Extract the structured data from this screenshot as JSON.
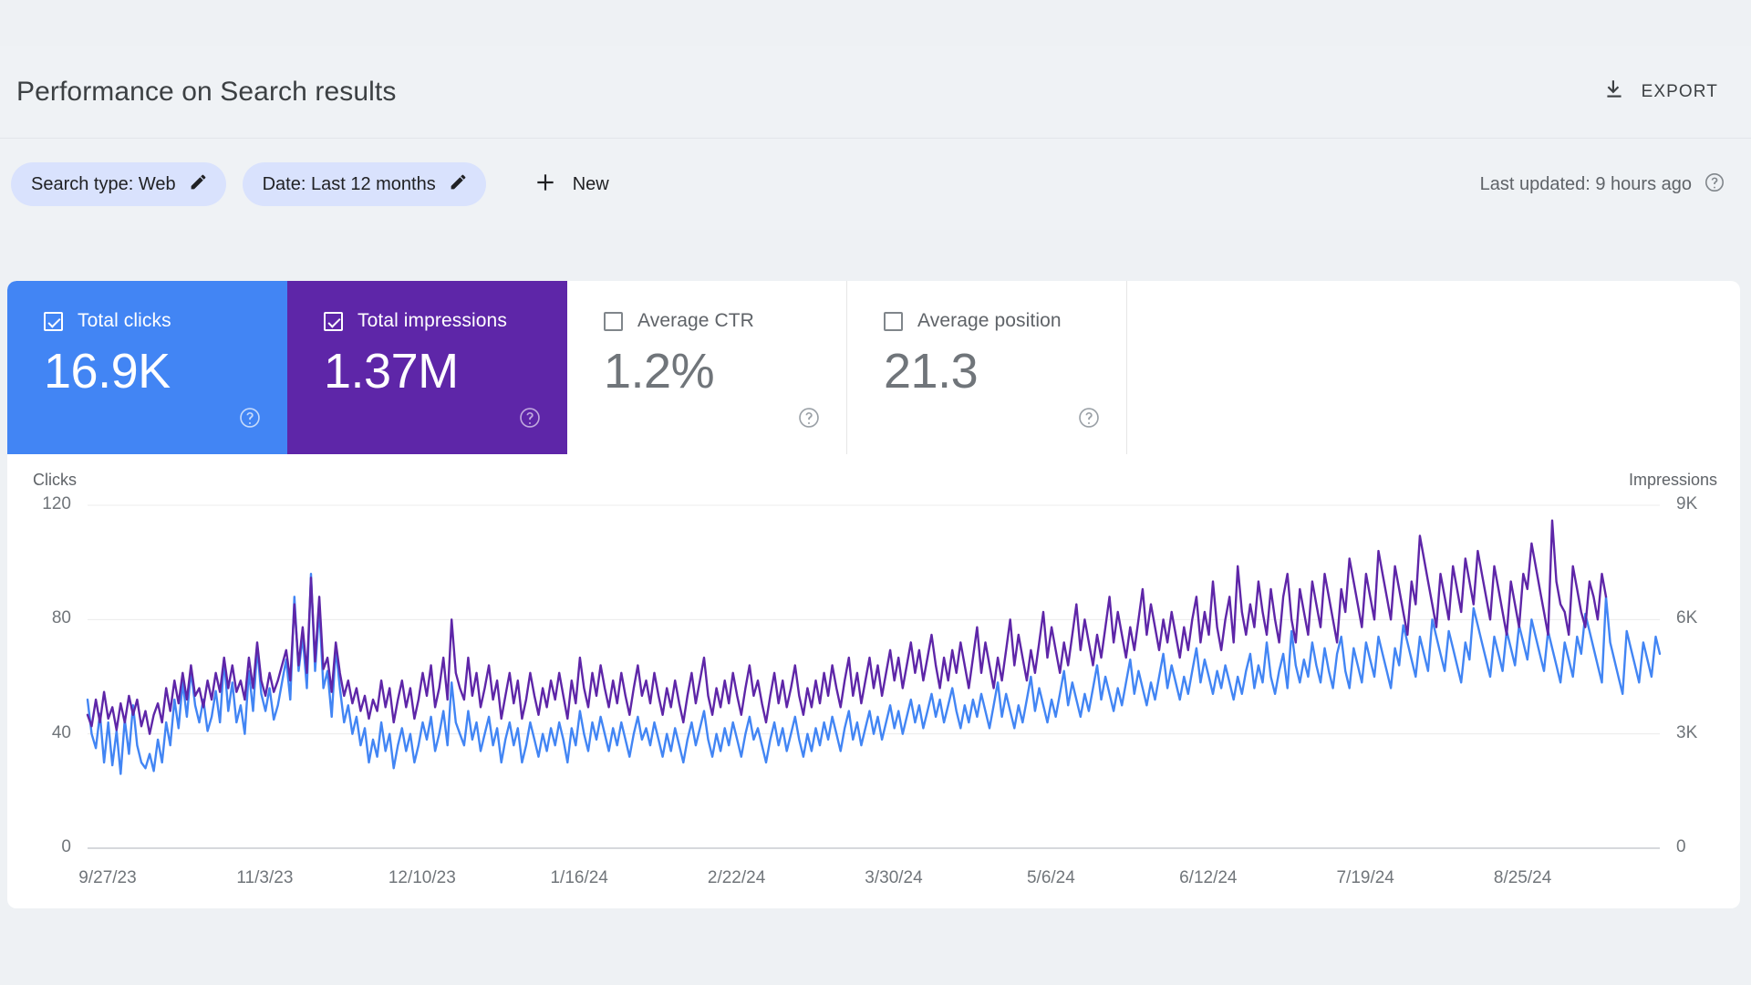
{
  "header": {
    "title": "Performance on Search results",
    "export_label": "EXPORT",
    "export_icon": "download-icon"
  },
  "filters": {
    "chips": [
      {
        "label": "Search type: Web",
        "edit_icon": "pencil-icon"
      },
      {
        "label": "Date: Last 12 months",
        "edit_icon": "pencil-icon"
      }
    ],
    "new_label": "New",
    "new_icon": "plus-icon",
    "last_updated": "Last updated: 9 hours ago",
    "help_icon": "help-circle-icon"
  },
  "metrics": [
    {
      "label": "Total clicks",
      "value": "16.9K",
      "checked": true,
      "color": "#4285f4",
      "help_icon": "help-circle-icon"
    },
    {
      "label": "Total impressions",
      "value": "1.37M",
      "checked": true,
      "color": "#5e26a8",
      "help_icon": "help-circle-icon"
    },
    {
      "label": "Average CTR",
      "value": "1.2%",
      "checked": false,
      "color": "#ffffff",
      "help_icon": "help-circle-icon"
    },
    {
      "label": "Average position",
      "value": "21.3",
      "checked": false,
      "color": "#ffffff",
      "help_icon": "help-circle-icon"
    }
  ],
  "chart_data": {
    "type": "line",
    "title": "",
    "xlabel": "",
    "ylabel": "Clicks",
    "y2label": "Impressions",
    "grid": true,
    "legend": "none",
    "ylim": [
      0,
      120
    ],
    "y2lim": [
      0,
      9000
    ],
    "yticks": [
      "0",
      "40",
      "80",
      "120"
    ],
    "y2ticks": [
      "0",
      "3K",
      "6K",
      "9K"
    ],
    "xticks": [
      "9/27/23",
      "11/3/23",
      "12/10/23",
      "1/16/24",
      "2/22/24",
      "3/30/24",
      "5/6/24",
      "6/12/24",
      "7/19/24",
      "8/25/24"
    ],
    "series": [
      {
        "name": "Total clicks",
        "color": "#4285f4",
        "axis": "left",
        "values": [
          52,
          40,
          35,
          47,
          30,
          44,
          29,
          41,
          26,
          45,
          33,
          50,
          36,
          30,
          28,
          33,
          27,
          38,
          30,
          44,
          36,
          52,
          42,
          58,
          46,
          62,
          50,
          44,
          52,
          41,
          46,
          55,
          44,
          66,
          48,
          58,
          44,
          50,
          40,
          62,
          48,
          70,
          54,
          48,
          56,
          45,
          50,
          58,
          66,
          52,
          88,
          62,
          74,
          56,
          96,
          62,
          84,
          56,
          62,
          46,
          70,
          56,
          44,
          50,
          40,
          46,
          36,
          42,
          30,
          38,
          32,
          44,
          34,
          40,
          28,
          36,
          42,
          34,
          40,
          30,
          36,
          44,
          38,
          46,
          34,
          40,
          48,
          36,
          58,
          44,
          40,
          36,
          48,
          38,
          44,
          34,
          40,
          46,
          36,
          42,
          30,
          38,
          44,
          36,
          42,
          30,
          36,
          44,
          38,
          32,
          40,
          34,
          42,
          36,
          44,
          38,
          30,
          42,
          36,
          48,
          40,
          34,
          44,
          38,
          46,
          40,
          34,
          42,
          36,
          44,
          38,
          32,
          40,
          46,
          38,
          42,
          36,
          44,
          38,
          32,
          40,
          34,
          42,
          36,
          30,
          38,
          44,
          36,
          42,
          48,
          38,
          32,
          40,
          34,
          42,
          36,
          44,
          38,
          32,
          40,
          46,
          38,
          42,
          36,
          30,
          38,
          44,
          36,
          42,
          34,
          40,
          46,
          38,
          32,
          40,
          34,
          42,
          36,
          44,
          38,
          46,
          40,
          34,
          42,
          48,
          38,
          44,
          36,
          42,
          48,
          40,
          46,
          38,
          44,
          50,
          42,
          48,
          40,
          46,
          52,
          44,
          50,
          42,
          48,
          54,
          46,
          52,
          44,
          50,
          56,
          48,
          42,
          50,
          44,
          52,
          46,
          54,
          48,
          42,
          50,
          58,
          46,
          54,
          48,
          42,
          50,
          44,
          52,
          60,
          48,
          56,
          50,
          44,
          52,
          46,
          54,
          62,
          50,
          58,
          52,
          46,
          54,
          48,
          56,
          64,
          52,
          60,
          54,
          48,
          56,
          50,
          58,
          66,
          54,
          62,
          56,
          50,
          58,
          52,
          60,
          68,
          56,
          64,
          58,
          52,
          60,
          54,
          62,
          70,
          58,
          66,
          60,
          54,
          62,
          56,
          64,
          58,
          52,
          60,
          54,
          62,
          68,
          56,
          64,
          58,
          72,
          60,
          54,
          62,
          68,
          56,
          76,
          64,
          58,
          66,
          60,
          72,
          64,
          58,
          70,
          62,
          56,
          68,
          74,
          62,
          56,
          70,
          64,
          58,
          72,
          66,
          60,
          74,
          68,
          62,
          56,
          70,
          64,
          78,
          72,
          66,
          60,
          74,
          68,
          62,
          80,
          74,
          68,
          62,
          76,
          70,
          64,
          58,
          72,
          66,
          84,
          78,
          72,
          66,
          60,
          74,
          68,
          62,
          76,
          70,
          64,
          78,
          72,
          66,
          80,
          74,
          68,
          62,
          76,
          70,
          64,
          58,
          72,
          66,
          60,
          74,
          68,
          82,
          76,
          70,
          64,
          58,
          88,
          72,
          66,
          60,
          54,
          76,
          70,
          64,
          58,
          72,
          66,
          60,
          74,
          68
        ]
      },
      {
        "name": "Total impressions",
        "color": "#5e26a8",
        "axis": "right",
        "values": [
          3500,
          3200,
          3900,
          3300,
          4100,
          3400,
          3700,
          3100,
          3800,
          3300,
          4000,
          3500,
          3900,
          3200,
          3600,
          3000,
          3500,
          3800,
          3300,
          4200,
          3600,
          4400,
          3800,
          4600,
          3900,
          4800,
          4000,
          4200,
          3700,
          4400,
          3900,
          4600,
          4100,
          5000,
          4200,
          4800,
          4100,
          4400,
          3900,
          5000,
          4200,
          5400,
          4400,
          4000,
          4600,
          4100,
          4400,
          4800,
          5200,
          4400,
          6400,
          4800,
          5800,
          4600,
          7100,
          4900,
          6600,
          4700,
          5000,
          4100,
          5400,
          4600,
          4000,
          4400,
          3800,
          4200,
          3600,
          4000,
          3400,
          3900,
          3600,
          4400,
          3700,
          4200,
          3300,
          3900,
          4400,
          3700,
          4200,
          3400,
          3900,
          4600,
          4000,
          4800,
          3700,
          4200,
          5000,
          3900,
          6000,
          4600,
          4200,
          3900,
          5000,
          4000,
          4600,
          3700,
          4200,
          4800,
          3900,
          4400,
          3400,
          4000,
          4600,
          3800,
          4400,
          3400,
          3900,
          4600,
          4000,
          3500,
          4200,
          3700,
          4400,
          3900,
          4600,
          4000,
          3400,
          4400,
          3800,
          5000,
          4200,
          3700,
          4600,
          4000,
          4800,
          4200,
          3700,
          4400,
          3800,
          4600,
          4000,
          3500,
          4200,
          4800,
          4000,
          4400,
          3800,
          4600,
          4000,
          3500,
          4200,
          3700,
          4400,
          3800,
          3300,
          4000,
          4600,
          3800,
          4400,
          5000,
          4000,
          3500,
          4200,
          3700,
          4400,
          3800,
          4600,
          4000,
          3500,
          4200,
          4800,
          4000,
          4400,
          3800,
          3300,
          4000,
          4600,
          3800,
          4400,
          3700,
          4200,
          4800,
          4000,
          3500,
          4200,
          3700,
          4400,
          3800,
          4600,
          4000,
          4800,
          4200,
          3700,
          4400,
          5000,
          4000,
          4600,
          3800,
          4400,
          5000,
          4200,
          4800,
          4000,
          4600,
          5200,
          4400,
          5000,
          4200,
          4800,
          5400,
          4600,
          5200,
          4400,
          5000,
          5600,
          4800,
          4200,
          5000,
          4400,
          5200,
          4600,
          5400,
          4800,
          4200,
          5000,
          5800,
          4600,
          5400,
          4800,
          4200,
          5000,
          4400,
          5200,
          6000,
          4800,
          5600,
          5000,
          4400,
          5200,
          4600,
          5400,
          6200,
          5000,
          5800,
          5200,
          4600,
          5400,
          4800,
          5600,
          6400,
          5200,
          6000,
          5400,
          4800,
          5600,
          5000,
          5800,
          6600,
          5400,
          6200,
          5600,
          5000,
          5800,
          5200,
          6000,
          6800,
          5600,
          6400,
          5800,
          5200,
          6000,
          5400,
          6200,
          5600,
          5000,
          5800,
          5200,
          6000,
          6600,
          5400,
          6200,
          5600,
          7000,
          5800,
          5200,
          6000,
          6600,
          5400,
          7400,
          6200,
          5600,
          6400,
          5800,
          7000,
          6200,
          5600,
          6800,
          6000,
          5400,
          6600,
          7200,
          6000,
          5400,
          6800,
          6200,
          5600,
          7000,
          6400,
          5800,
          7200,
          6600,
          6000,
          5400,
          6800,
          6200,
          7600,
          7000,
          6400,
          5800,
          7200,
          6600,
          6000,
          7800,
          7200,
          6600,
          6000,
          7400,
          6800,
          6200,
          5600,
          7000,
          6400,
          8200,
          7600,
          7000,
          6400,
          5800,
          7200,
          6600,
          6000,
          7400,
          6800,
          6200,
          7600,
          7000,
          6400,
          7800,
          7200,
          6600,
          6000,
          7400,
          6800,
          6200,
          5600,
          7000,
          6400,
          5800,
          7200,
          6800,
          8000,
          7400,
          6800,
          6200,
          5600,
          8600,
          7000,
          6400,
          6200,
          5600,
          7400,
          6800,
          6200,
          5800,
          7000,
          6600,
          6000,
          7200,
          6600
        ]
      }
    ]
  }
}
